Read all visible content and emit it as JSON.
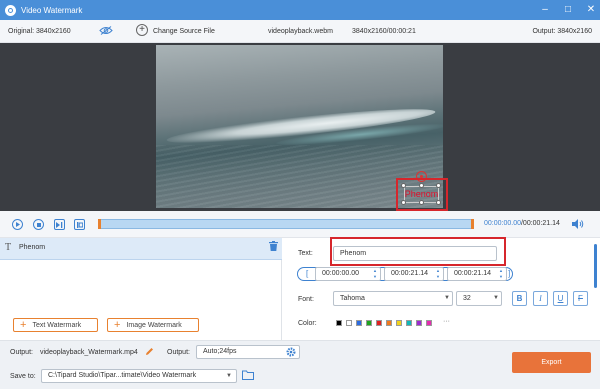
{
  "window": {
    "title": "Video Watermark",
    "buttons": [
      "–",
      "□",
      "✕"
    ]
  },
  "info": {
    "original": "Original: 3840x2160",
    "change_source": "Change Source File",
    "filename": "videoplayback.webm",
    "meta": "3840x2160/00:00:21",
    "output": "Output: 3840x2160"
  },
  "watermark": {
    "preview_text": "Phenom",
    "preview_color": "#e0112b"
  },
  "timeline": {
    "current": "00:00:00.00",
    "total": "/00:00:21.14"
  },
  "layers": [
    {
      "type_glyph": "T",
      "name": "Phenom"
    }
  ],
  "add_buttons": {
    "text": "Text Watermark",
    "image": "Image Watermark"
  },
  "settings": {
    "text_label": "Text:",
    "text_value": "Phenom",
    "start_time": "00:00:00.00",
    "duration": "00:00:21.14",
    "end_time": "00:00:21.14",
    "font_label": "Font:",
    "font": "Tahoma",
    "size": "32",
    "format": {
      "bold": "B",
      "italic": "I",
      "underline": "U",
      "strike": "F"
    },
    "color_label": "Color:",
    "colors": [
      "#000000",
      "#ffffff",
      "#2d6ce0",
      "#1fa51f",
      "#e02020",
      "#f07a1e",
      "#f1d21b",
      "#12b8b8",
      "#9c2bd1",
      "#e42bb0"
    ],
    "more": "···"
  },
  "footer": {
    "output_label": "Output:",
    "output_file": "videoplayback_Watermark.mp4",
    "output_format_label": "Output:",
    "output_format": "Auto;24fps",
    "save_label": "Save to:",
    "save_path": "C:\\Tipard Studio\\Tipar...timate\\Video Watermark",
    "export": "Export"
  },
  "colors": {
    "accent": "#3e82d0",
    "titlebar": "#4a8fd8",
    "export": "#e8733a",
    "highlight": "#d6262c"
  }
}
